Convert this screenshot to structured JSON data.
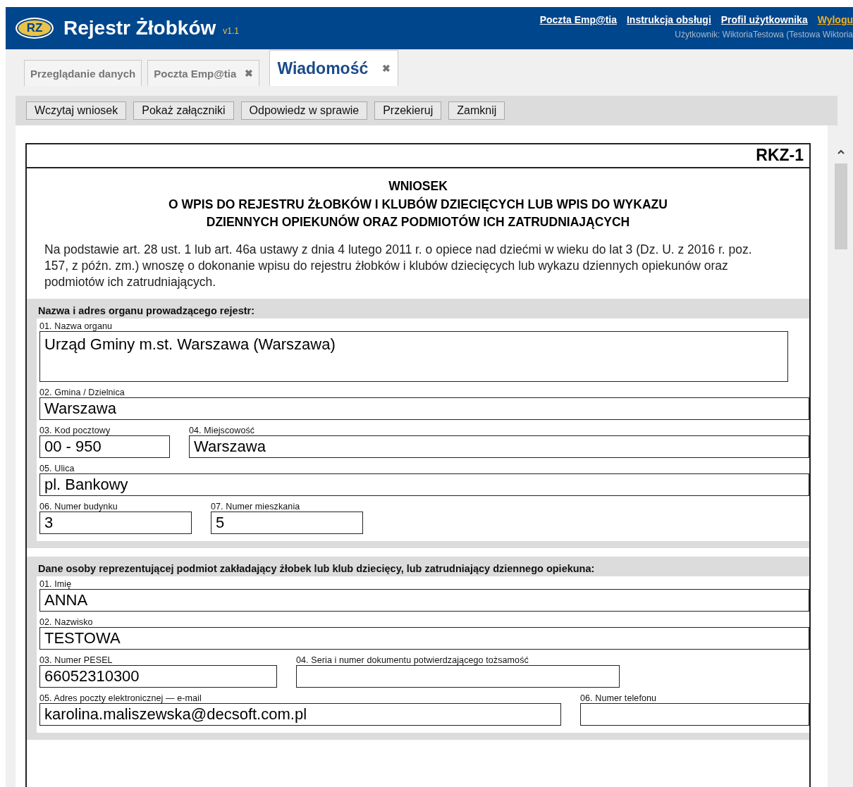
{
  "header": {
    "logo": "RZ",
    "title": "Rejestr Żłobków",
    "version": "v1.1",
    "links": [
      {
        "label": "Poczta Emp@tia",
        "kind": "normal"
      },
      {
        "label": "Instrukcja obsługi",
        "kind": "normal"
      },
      {
        "label": "Profil użytkownika",
        "kind": "normal"
      },
      {
        "label": "Wylogu",
        "kind": "logout"
      }
    ],
    "user": "Użytkownik: WiktoriaTestowa (Testowa Wiktoria"
  },
  "tabs": [
    {
      "label": "Przeglądanie danych",
      "selected": false,
      "closable": false
    },
    {
      "label": "Poczta Emp@tia",
      "selected": false,
      "closable": true
    },
    {
      "label": "Wiadomość",
      "selected": true,
      "closable": true
    }
  ],
  "close_mark": "✖",
  "toolbar": [
    "Wczytaj wniosek",
    "Pokaż załączniki",
    "Odpowiedz w sprawie",
    "Przekieruj",
    "Zamknij"
  ],
  "form": {
    "code": "RKZ-1",
    "title_lines": [
      "WNIOSEK",
      "O WPIS DO REJESTRU ŻŁOBKÓW I KLUBÓW DZIECIĘCYCH LUB WPIS DO WYKAZU",
      "DZIENNYCH OPIEKUNÓW ORAZ PODMIOTÓW ICH ZATRUDNIAJĄCYCH"
    ],
    "intro": "Na podstawie art. 28 ust. 1 lub art. 46a ustawy z dnia 4 lutego 2011 r. o opiece nad dziećmi w wieku do lat 3 (Dz. U. z 2016 r. poz. 157, z późn. zm.) wnoszę o dokonanie wpisu do rejestru żłobków i klubów dziecięcych lub wykazu dziennych opiekunów oraz podmiotów ich zatrudniających.",
    "sections": [
      {
        "heading": "Nazwa i adres organu prowadzącego rejestr:",
        "rows": [
          [
            {
              "label": "01. Nazwa organu",
              "value": "Urząd Gminy m.st. Warszawa (Warszawa)",
              "kind": "multiline"
            }
          ],
          [
            {
              "label": "02. Gmina / Dzielnica",
              "value": "Warszawa",
              "kind": "line"
            }
          ],
          [
            {
              "label": "03. Kod pocztowy",
              "value": "00 - 950",
              "kind": "line"
            },
            {
              "label": "04. Miejscowość",
              "value": "Warszawa",
              "kind": "line"
            }
          ],
          [
            {
              "label": "05. Ulica",
              "value": "pl. Bankowy",
              "kind": "line"
            }
          ],
          [
            {
              "label": "06. Numer budynku",
              "value": "3",
              "kind": "line"
            },
            {
              "label": "07. Numer mieszkania",
              "value": "5",
              "kind": "line"
            }
          ]
        ]
      },
      {
        "heading": "Dane osoby reprezentującej podmiot zakładający żłobek lub klub dziecięcy, lub zatrudniający dziennego opiekuna:",
        "rows": [
          [
            {
              "label": "01. Imię",
              "value": "ANNA",
              "kind": "line"
            }
          ],
          [
            {
              "label": "02. Nazwisko",
              "value": "TESTOWA",
              "kind": "line"
            }
          ],
          [
            {
              "label": "03. Numer PESEL",
              "value": "66052310300",
              "kind": "line"
            },
            {
              "label": "04. Seria i numer dokumentu potwierdzającego tożsamość",
              "kind": "line"
            }
          ],
          [
            {
              "label": "05. Adres poczty elektronicznej — e-mail",
              "value": "karolina.maliszewska@decsoft.com.pl",
              "kind": "line"
            },
            {
              "label": "06. Numer telefonu",
              "kind": "line"
            }
          ]
        ]
      }
    ]
  }
}
